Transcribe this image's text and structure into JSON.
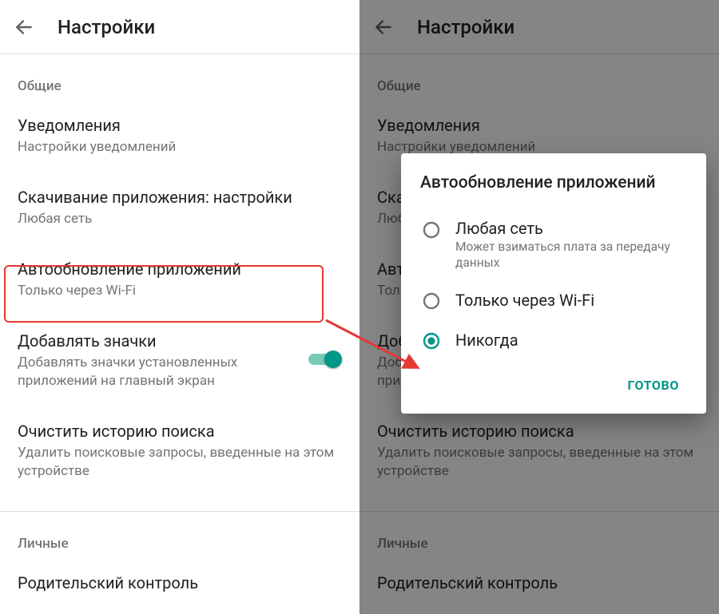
{
  "left": {
    "title": "Настройки",
    "section1": "Общие",
    "items": [
      {
        "primary": "Уведомления",
        "secondary": "Настройки уведомлений"
      },
      {
        "primary": "Скачивание приложения: настройки",
        "secondary": "Любая сеть"
      },
      {
        "primary": "Автообновление приложений",
        "secondary": "Только через Wi-Fi"
      },
      {
        "primary": "Добавлять значки",
        "secondary": "Добавлять значки установленных приложений на главный экран"
      },
      {
        "primary": "Очистить историю поиска",
        "secondary": "Удалить поисковые запросы, введенные на этом устройстве"
      }
    ],
    "section2": "Личные",
    "items2": [
      {
        "primary": "Родительский контроль"
      }
    ]
  },
  "right": {
    "title": "Настройки",
    "section1": "Общие",
    "items": [
      {
        "primary": "Уведомления",
        "secondary": "Настройки уведомлений"
      },
      {
        "primary": "Скачивание приложения: настройки",
        "secondary": "Любая сеть"
      },
      {
        "primary": "Автообновление приложений",
        "secondary": "Только через Wi-Fi"
      },
      {
        "primary": "Добавлять значки",
        "secondary": "Добавлять значки установленных приложений на главный экран"
      },
      {
        "primary": "Очистить историю поиска",
        "secondary": "Удалить поисковые запросы, введенные на этом устройстве"
      }
    ],
    "section2": "Личные",
    "items2": [
      {
        "primary": "Родительский контроль"
      }
    ]
  },
  "dialog": {
    "title": "Автообновление приложений",
    "options": [
      {
        "primary": "Любая сеть",
        "secondary": "Может взиматься плата за передачу данных"
      },
      {
        "primary": "Только через Wi-Fi"
      },
      {
        "primary": "Никогда"
      }
    ],
    "selected_index": 2,
    "confirm": "ГОТОВО"
  },
  "colors": {
    "accent": "#009688",
    "highlight": "#e53935",
    "arrow": "#e53935"
  }
}
